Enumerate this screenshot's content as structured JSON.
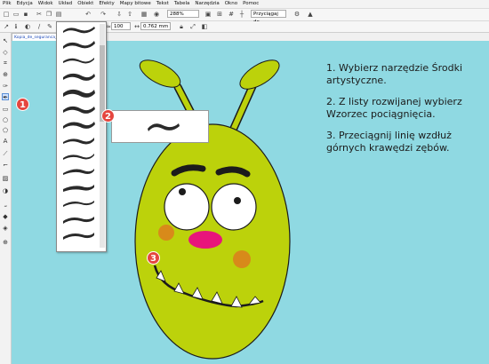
{
  "menu": [
    "Plik",
    "Edycja",
    "Widok",
    "Układ",
    "Obiekt",
    "Efekty",
    "Mapy bitowe",
    "Tekst",
    "Tabela",
    "Narzędzia",
    "Okno",
    "Pomoc"
  ],
  "toolbar": {
    "zoom_value": "288%",
    "snap_label": "Przyciągaj do",
    "size_value": "100",
    "width_value": "0.762 mm"
  },
  "document_tab": "Kopia_de_seguranca_c",
  "instructions": [
    "1. Wybierz narzędzie Środki artystyczne.",
    "2. Z listy rozwijanej wybierz Wzorzec pociągnięcia.",
    "3. Przeciągnij linię wzdłuż górnych krawędzi zębów."
  ],
  "badges": [
    "1",
    "2",
    "3"
  ],
  "colors": {
    "canvas": "#8fd9e2",
    "monster_body": "#bcd20b",
    "cheeks": "#d88a1a",
    "nose": "#e8157b",
    "badge": "#e5463f"
  },
  "icons": [
    "new-icon",
    "open-icon",
    "save-icon",
    "undo-icon",
    "redo-icon",
    "import-icon",
    "export-icon",
    "pick-tool-icon",
    "artistic-media-tool-icon",
    "zoom-tool-icon",
    "freehand-icon",
    "text-tool-icon",
    "fill-tool-icon"
  ]
}
